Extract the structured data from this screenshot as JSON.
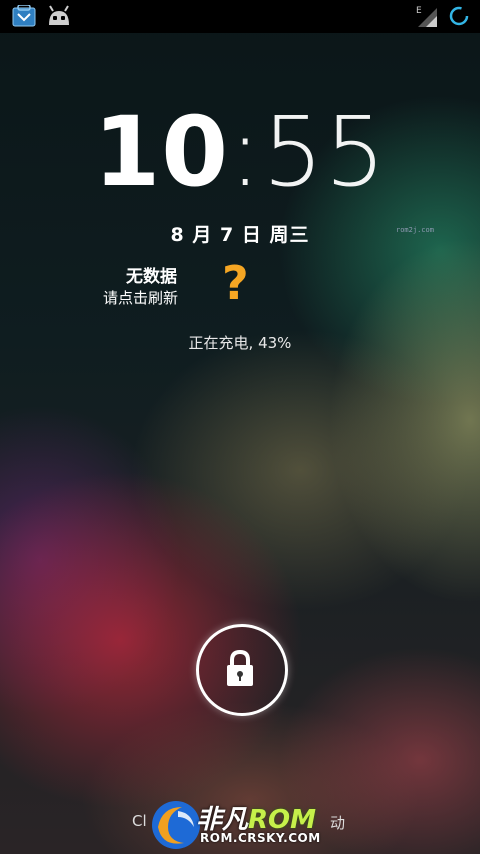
{
  "status_bar": {
    "left_icons": [
      "store-icon",
      "android-robot-icon"
    ],
    "network_type": "E",
    "right_icons": [
      "signal-icon",
      "loading-ring-icon"
    ]
  },
  "clock": {
    "hours": "10",
    "separator": ":",
    "minutes": "55"
  },
  "date": "8 月 7 日 周三",
  "small_watermark": "rom2j.com",
  "weather": {
    "title": "无数据",
    "subtitle": "请点击刷新",
    "icon": "question-mark-icon"
  },
  "charging_status": "正在充电, 43%",
  "lock_icon": "padlock-icon",
  "bottom_hint": {
    "left": "Cl",
    "right": "动"
  },
  "watermark_logo": {
    "brand_part1": "非凡",
    "brand_part2": "ROM",
    "url": "ROM.CRSKY.COM"
  },
  "colors": {
    "accent_question": "#f5a623",
    "loading_ring": "#33b5e5",
    "brand_green": "#c6f04a"
  }
}
